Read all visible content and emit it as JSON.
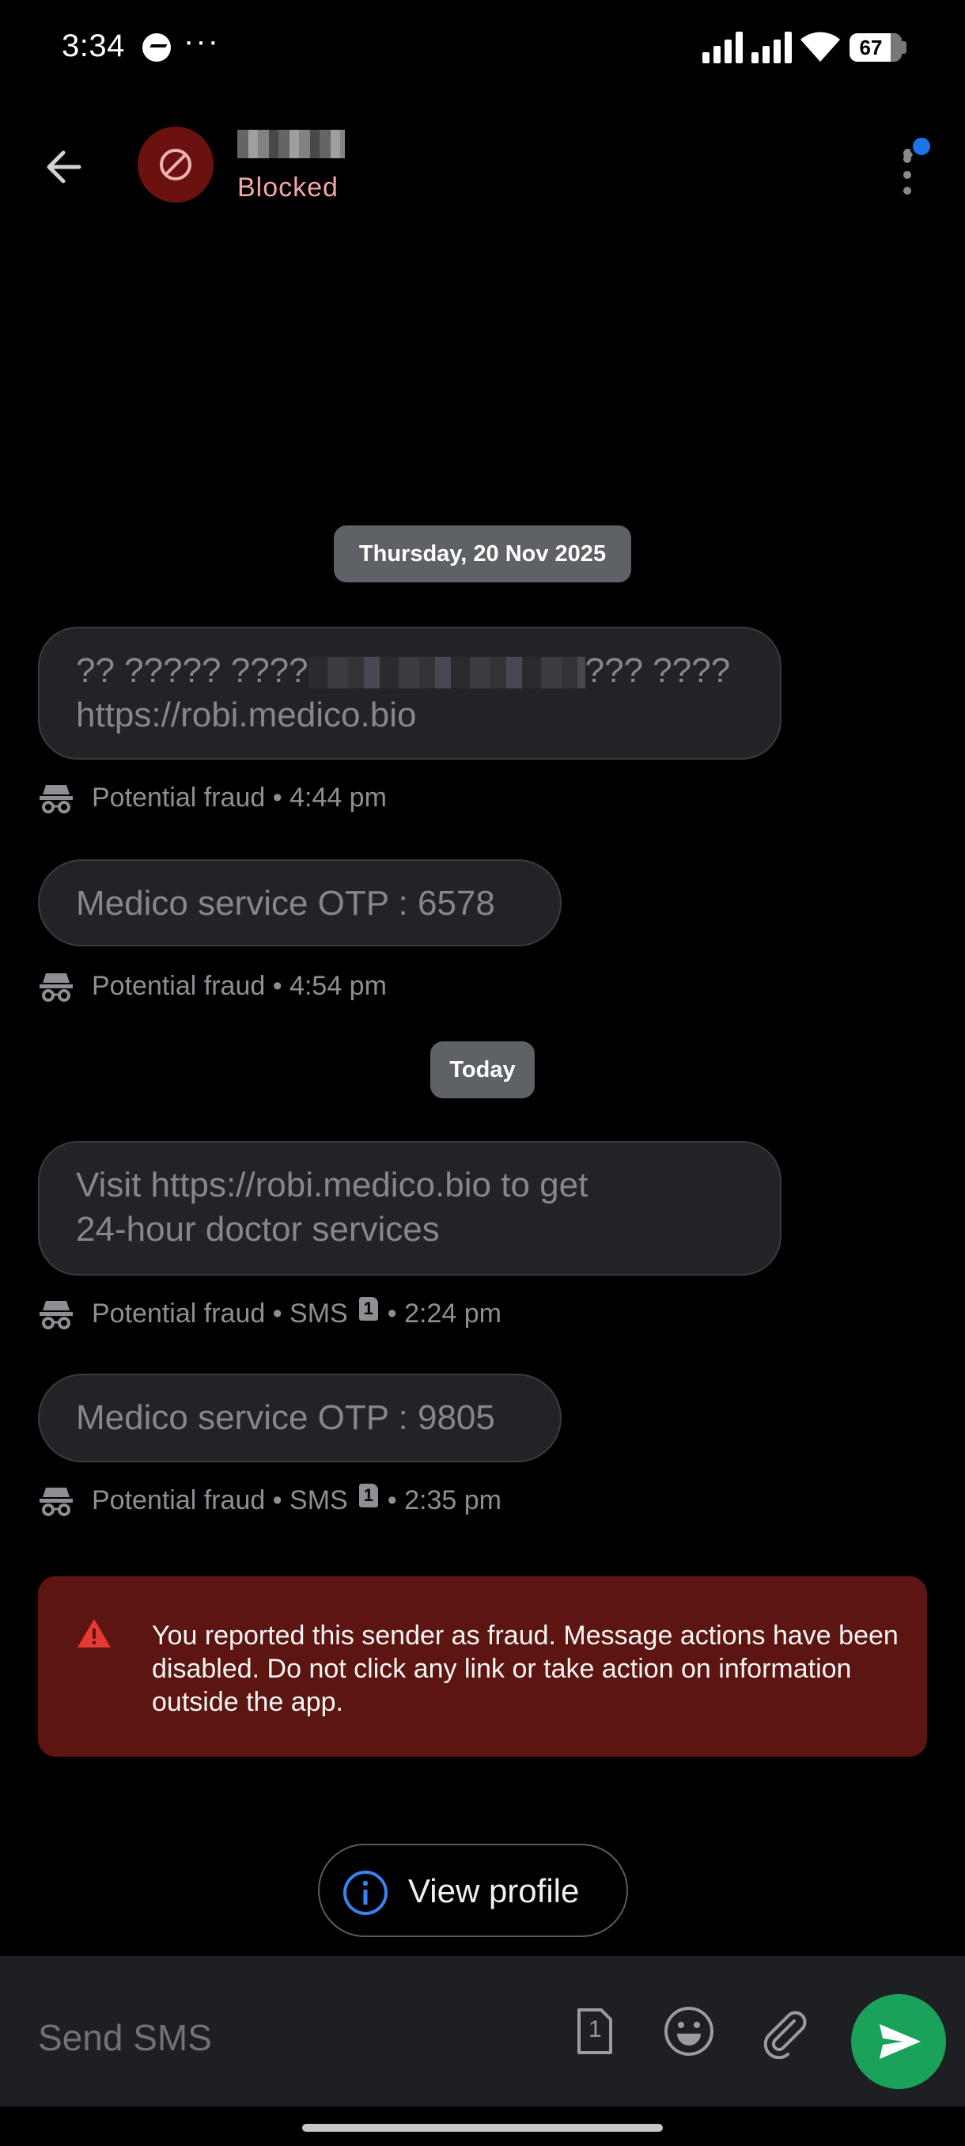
{
  "status_bar": {
    "time": "3:34",
    "more": "···",
    "battery": "67"
  },
  "header": {
    "status": "Blocked"
  },
  "conversation": {
    "date_chip_1": "Thursday, 20 Nov 2025",
    "date_chip_2": "Today",
    "messages": [
      {
        "text_line1_start": "?? ????? ????",
        "text_line1_end": "??? ????",
        "text_line2": "https://robi.medico.bio",
        "meta": "Potential fraud • 4:44 pm"
      },
      {
        "text": "Medico service OTP : 6578",
        "meta": "Potential fraud • 4:54 pm"
      },
      {
        "text_line1": "Visit https://robi.medico.bio to get",
        "text_line2": "24-hour doctor services",
        "meta_prefix": "Potential fraud • SMS",
        "sim": "1",
        "meta_suffix": "• 2:24 pm"
      },
      {
        "text": "Medico service OTP : 9805",
        "meta_prefix": "Potential fraud • SMS",
        "sim": "1",
        "meta_suffix": "• 2:35 pm"
      }
    ]
  },
  "warning": {
    "text": "You reported this sender as fraud. Message actions have been disabled. Do not click any link or take action on information outside the app."
  },
  "profile_button": {
    "label": "View profile"
  },
  "compose": {
    "placeholder": "Send SMS",
    "sim_label": "1"
  },
  "colors": {
    "background": "#000000",
    "bubble": "#222326",
    "warning_bg": "#5c1510",
    "blocked_text": "#f2a6a6",
    "send_button": "#1aa25a",
    "accent_blue": "#1a73e8"
  },
  "icons": {
    "back": "arrow-left-icon",
    "avatar": "blocked-circle-icon",
    "menu": "more-vert-icon",
    "fraud": "incognito-spy-icon",
    "warning": "warning-triangle-icon",
    "profile": "info-circle-icon",
    "sim": "sim-card-icon",
    "emoji": "emoji-icon",
    "attach": "paperclip-icon",
    "send": "send-icon"
  }
}
